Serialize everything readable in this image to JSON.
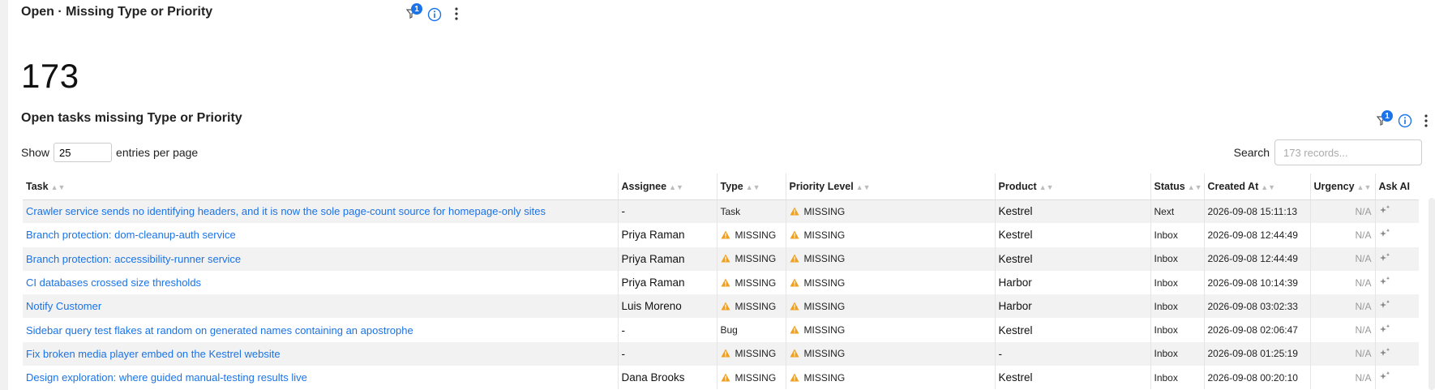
{
  "widget": {
    "title": "Open · Missing Type or Priority",
    "filter_badge": "1",
    "count": "173"
  },
  "table_panel": {
    "title": "Open tasks missing Type or Priority",
    "filter_badge": "1",
    "show_label": "Show",
    "entries_value": "25",
    "entries_suffix": "entries per page",
    "search_label": "Search",
    "search_placeholder": "173 records..."
  },
  "columns": [
    "Task",
    "Assignee",
    "Type",
    "Priority Level",
    "Product",
    "Status",
    "Created At",
    "Urgency",
    "Ask AI"
  ],
  "rows": [
    {
      "task": "Crawler service sends no identifying headers, and it is now the sole page-count source for homepage-only sites",
      "assignee": "-",
      "type": "Task",
      "type_missing": false,
      "priority": "MISSING",
      "product": "Kestrel",
      "status": "Next",
      "created": "2026-09-08 15:11:13",
      "urgency": "N/A"
    },
    {
      "task": "Branch protection: dom-cleanup-auth service",
      "assignee": "Priya Raman",
      "type": "MISSING",
      "type_missing": true,
      "priority": "MISSING",
      "product": "Kestrel",
      "status": "Inbox",
      "created": "2026-09-08 12:44:49",
      "urgency": "N/A"
    },
    {
      "task": "Branch protection: accessibility-runner service",
      "assignee": "Priya Raman",
      "type": "MISSING",
      "type_missing": true,
      "priority": "MISSING",
      "product": "Kestrel",
      "status": "Inbox",
      "created": "2026-09-08 12:44:49",
      "urgency": "N/A"
    },
    {
      "task": "CI databases crossed size thresholds",
      "assignee": "Priya Raman",
      "type": "MISSING",
      "type_missing": true,
      "priority": "MISSING",
      "product": "Harbor",
      "status": "Inbox",
      "created": "2026-09-08 10:14:39",
      "urgency": "N/A"
    },
    {
      "task": "Notify Customer",
      "assignee": "Luis Moreno",
      "type": "MISSING",
      "type_missing": true,
      "priority": "MISSING",
      "product": "Harbor",
      "status": "Inbox",
      "created": "2026-09-08 03:02:33",
      "urgency": "N/A"
    },
    {
      "task": "Sidebar query test flakes at random on generated names containing an apostrophe",
      "assignee": "-",
      "type": "Bug",
      "type_missing": false,
      "priority": "MISSING",
      "product": "Kestrel",
      "status": "Inbox",
      "created": "2026-09-08 02:06:47",
      "urgency": "N/A"
    },
    {
      "task": "Fix broken media player embed on the Kestrel website",
      "assignee": "-",
      "type": "MISSING",
      "type_missing": true,
      "priority": "MISSING",
      "product": "-",
      "status": "Inbox",
      "created": "2026-09-08 01:25:19",
      "urgency": "N/A"
    },
    {
      "task": "Design exploration: where guided manual-testing results live",
      "assignee": "Dana Brooks",
      "type": "MISSING",
      "type_missing": true,
      "priority": "MISSING",
      "product": "Kestrel",
      "status": "Inbox",
      "created": "2026-09-08 00:20:10",
      "urgency": "N/A"
    }
  ],
  "icons": {
    "filter": "filter-icon",
    "info": "info-icon",
    "menu": "kebab-menu-icon",
    "warning": "warning-icon",
    "sparkle": "sparkle-icon",
    "sort": "sort-icon"
  },
  "colors": {
    "link": "#1a73e8",
    "badge": "#1a73e8",
    "warning": "#f0a020",
    "stripe": "#f2f2f2"
  }
}
